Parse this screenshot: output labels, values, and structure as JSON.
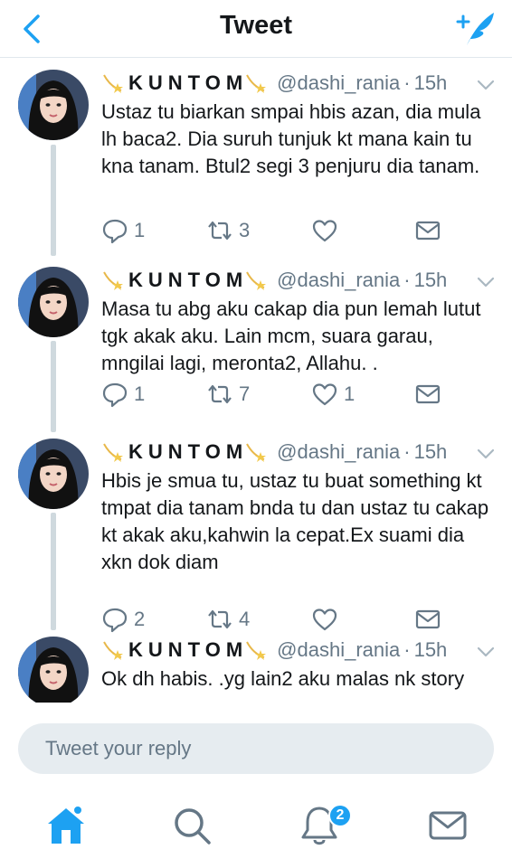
{
  "header": {
    "title": "Tweet",
    "back_icon": "chevron-left-icon",
    "compose_icon": "compose-tweet-icon",
    "accent": "#1da1f2"
  },
  "tweets": [
    {
      "name": "KUNTOM",
      "handle": "@dashi_rania",
      "time": "15h",
      "text": "Ustaz tu biarkan smpai hbis azan, dia mula lh baca2. Dia suruh tunjuk kt mana kain tu kna tanam. Btul2 segi 3 penjuru dia tanam.",
      "replies": "1",
      "retweets": "3",
      "likes": ""
    },
    {
      "name": "KUNTOM",
      "handle": "@dashi_rania",
      "time": "15h",
      "text": "Masa tu abg aku cakap dia pun lemah lutut tgk akak aku. Lain mcm, suara garau, mngilai lagi, meronta2, Allahu. .",
      "replies": "1",
      "retweets": "7",
      "likes": "1"
    },
    {
      "name": "KUNTOM",
      "handle": "@dashi_rania",
      "time": "15h",
      "text": "Hbis je smua tu, ustaz tu buat something kt tmpat dia tanam bnda tu dan ustaz tu cakap kt akak aku,kahwin la cepat.Ex suami dia xkn dok diam",
      "replies": "2",
      "retweets": "4",
      "likes": ""
    },
    {
      "name": "KUNTOM",
      "handle": "@dashi_rania",
      "time": "15h",
      "text": "Ok dh habis. .yg lain2 aku malas nk story",
      "replies": "",
      "retweets": "",
      "likes": ""
    }
  ],
  "reply": {
    "placeholder": "Tweet your reply"
  },
  "tabbar": {
    "items": [
      "home-icon",
      "search-icon",
      "notifications-icon",
      "messages-icon"
    ],
    "notification_badge": "2"
  }
}
